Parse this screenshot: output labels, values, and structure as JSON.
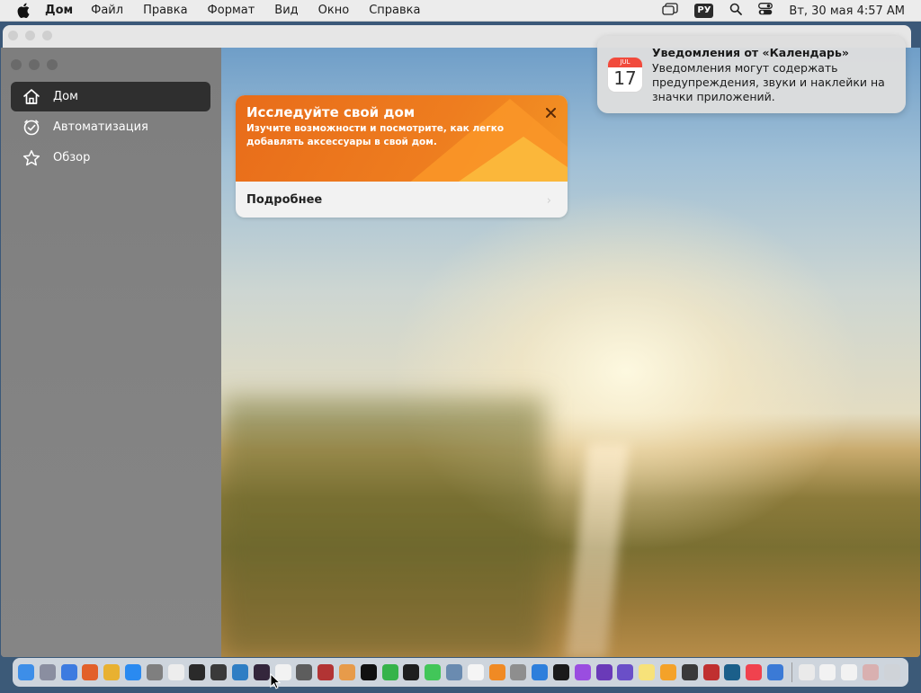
{
  "menubar": {
    "app_name": "Дом",
    "items": [
      "Файл",
      "Правка",
      "Формат",
      "Вид",
      "Окно",
      "Справка"
    ],
    "input_language": "РУ",
    "clock": "Вт, 30 мая  4:57 AM"
  },
  "sidebar": {
    "items": [
      {
        "label": "Дом",
        "icon": "house-icon",
        "active": true
      },
      {
        "label": "Автоматизация",
        "icon": "clock-check-icon",
        "active": false
      },
      {
        "label": "Обзор",
        "icon": "star-icon",
        "active": false
      }
    ]
  },
  "promo": {
    "title": "Исследуйте свой дом",
    "subtitle": "Изучите возможности и посмотрите, как легко добавлять аксессуары в свой дом.",
    "more_label": "Подробнее"
  },
  "notification": {
    "title": "Уведомления от «Календарь»",
    "body": "Уведомления могут содержать предупреждения, звуки и наклейки на значки приложений.",
    "calendar_month": "JUL",
    "calendar_day": "17"
  },
  "dock": {
    "apps": [
      {
        "name": "finder",
        "color": "#3d8ee8"
      },
      {
        "name": "launchpad",
        "color": "#8a8ea0"
      },
      {
        "name": "safari",
        "color": "#3d7be0"
      },
      {
        "name": "firefox",
        "color": "#e2602a"
      },
      {
        "name": "chrome",
        "color": "#e8b131"
      },
      {
        "name": "app-store",
        "color": "#2a8af0"
      },
      {
        "name": "system-settings",
        "color": "#7f7f7f"
      },
      {
        "name": "textedit",
        "color": "#ededed"
      },
      {
        "name": "terminal",
        "color": "#2a2a2a"
      },
      {
        "name": "script-editor",
        "color": "#3a3a3a"
      },
      {
        "name": "vscode",
        "color": "#2f7ec4"
      },
      {
        "name": "home",
        "color": "#34263c"
      },
      {
        "name": "news",
        "color": "#f2f2f2"
      },
      {
        "name": "chess",
        "color": "#5d5d5d"
      },
      {
        "name": "dictionary",
        "color": "#b23434"
      },
      {
        "name": "photos",
        "color": "#e79b4a"
      },
      {
        "name": "tv",
        "color": "#111111"
      },
      {
        "name": "find-my",
        "color": "#36b34a"
      },
      {
        "name": "stocks",
        "color": "#1e1e1e"
      },
      {
        "name": "messages",
        "color": "#42c659"
      },
      {
        "name": "preview",
        "color": "#6a8bb0"
      },
      {
        "name": "calendar",
        "color": "#f5f5f5"
      },
      {
        "name": "books",
        "color": "#f08a24"
      },
      {
        "name": "calculator",
        "color": "#8e8e8e"
      },
      {
        "name": "keynote",
        "color": "#2d7fdc"
      },
      {
        "name": "clock",
        "color": "#1a1a1a"
      },
      {
        "name": "podcasts",
        "color": "#9a4de0"
      },
      {
        "name": "visual-studio",
        "color": "#6a3ab8"
      },
      {
        "name": "siri",
        "color": "#6a4fc8"
      },
      {
        "name": "notes",
        "color": "#f7e27a"
      },
      {
        "name": "home-2",
        "color": "#f4a229"
      },
      {
        "name": "quicktime",
        "color": "#3a3a3a"
      },
      {
        "name": "photo-booth",
        "color": "#c03030"
      },
      {
        "name": "screen-sharing",
        "color": "#1b5f8a"
      },
      {
        "name": "music",
        "color": "#f0424e"
      },
      {
        "name": "xcode",
        "color": "#3b7ad6"
      }
    ],
    "trailing": [
      {
        "name": "downloads",
        "color": "#eaeaea"
      },
      {
        "name": "document-1",
        "color": "#f2f2f2"
      },
      {
        "name": "document-2",
        "color": "#f2f2f2"
      },
      {
        "name": "document-3",
        "color": "#d9b0b0"
      },
      {
        "name": "trash",
        "color": "#cfd3d8"
      }
    ]
  }
}
